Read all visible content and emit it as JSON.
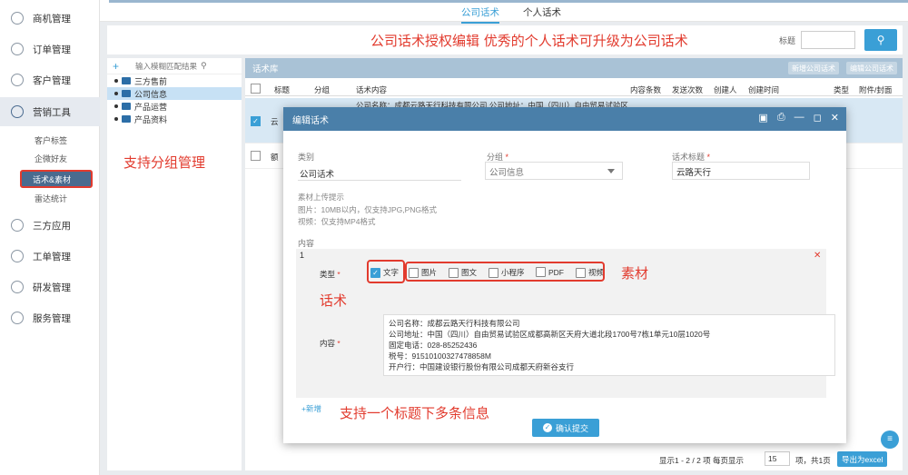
{
  "sidebar": {
    "items": [
      {
        "label": "商机管理",
        "icon": "opportunity-icon"
      },
      {
        "label": "订单管理",
        "icon": "order-icon"
      },
      {
        "label": "客户管理",
        "icon": "customer-icon"
      },
      {
        "label": "营销工具",
        "icon": "marketing-icon"
      },
      {
        "label": "三方应用",
        "icon": "apps-icon"
      },
      {
        "label": "工单管理",
        "icon": "ticket-icon"
      },
      {
        "label": "研发管理",
        "icon": "dev-icon"
      },
      {
        "label": "服务管理",
        "icon": "service-icon"
      }
    ],
    "sub_items": [
      "客户标签",
      "企微好友",
      "话术&素材",
      "雷达统计"
    ]
  },
  "top_tabs": [
    "公司话术",
    "个人话术"
  ],
  "search": {
    "label": "标题"
  },
  "tree": {
    "placeholder": "输入模糊匹配结果",
    "nodes": [
      "三方售前",
      "公司信息",
      "产品运营",
      "产品资料"
    ]
  },
  "panel": {
    "title": "话术库",
    "btn_new": "新增公司话术",
    "btn_edit": "编辑公司话术",
    "columns": [
      "标题",
      "分组",
      "话术内容",
      "内容条数",
      "发送次数",
      "创建人",
      "创建时间",
      "类型",
      "附件/封面"
    ],
    "row1_title": "云",
    "row1_content": "公司名称：成都云路天行科技有限公司 公司地址：中国（四川）自由贸易试验区",
    "row2_title": "额",
    "pager": "显示1 - 2 / 2 项  每页显示",
    "page_size": "15",
    "pager_tail": "项，共1页",
    "export": "导出为excel"
  },
  "modal": {
    "title": "编辑话术",
    "category_label": "类别",
    "category_value": "公司话术",
    "group_label": "分组",
    "group_value": "公司信息",
    "title_label": "话术标题",
    "title_value": "云路天行",
    "upload_hint_title": "素材上传提示",
    "upload_hint_image": "图片：10MB以内，仅支持JPG,PNG格式",
    "upload_hint_video": "视频：仅支持MP4格式",
    "content_section": "内容",
    "item_index": "1",
    "type_label": "类型",
    "types": [
      "文字",
      "图片",
      "图文",
      "小程序",
      "PDF",
      "视频"
    ],
    "content_label": "内容",
    "content_lines": [
      "公司名称：成都云路天行科技有限公司",
      "公司地址：中国（四川）自由贸易试验区成都高新区天府大道北段1700号7栋1单元10层1020号",
      "固定电话：028-85252436",
      "税号：91510100327478858M",
      "开户行：中国建设银行股份有限公司成都天府新谷支行"
    ],
    "add_label": "+新增",
    "submit_label": "确认提交"
  },
  "annotations": {
    "top": "公司话术授权编辑   优秀的个人话术可升级为公司话术",
    "group": "支持分组管理",
    "speech": "话术",
    "material": "素材",
    "multi": "支持一个标题下多条信息"
  },
  "colors": {
    "accent": "#3a9fd6",
    "modal_header": "#4a7fa9",
    "annotation": "#e23b2e"
  }
}
